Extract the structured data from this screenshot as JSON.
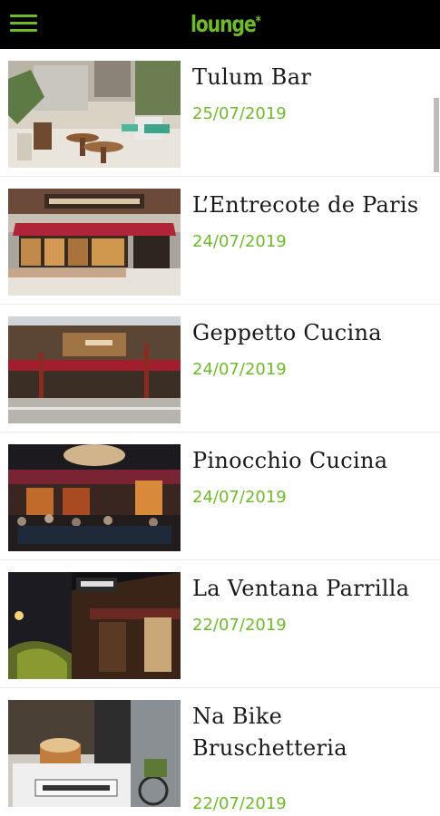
{
  "app": {
    "logo_text": "lounge",
    "logo_mark": "*",
    "accent_color": "#6fba2c"
  },
  "toolbar": {
    "menu_icon": "hamburger-menu-icon"
  },
  "items": [
    {
      "title": "Tulum Bar",
      "date": "25/07/2019",
      "image": "tulum-bar-photo"
    },
    {
      "title": " L’Entrecote de Paris",
      "date": "24/07/2019",
      "image": "entrecote-de-paris-photo"
    },
    {
      "title": "Geppetto Cucina",
      "date": "24/07/2019",
      "image": "geppetto-cucina-photo"
    },
    {
      "title": "Pinocchio Cucina",
      "date": "24/07/2019",
      "image": "pinocchio-cucina-photo"
    },
    {
      "title": "La Ventana Parrilla",
      "date": "22/07/2019",
      "image": "la-ventana-parrilla-photo"
    },
    {
      "title": "Na Bike Bruschetteria",
      "date": "22/07/2019",
      "image": "na-bike-bruschetteria-photo"
    }
  ]
}
